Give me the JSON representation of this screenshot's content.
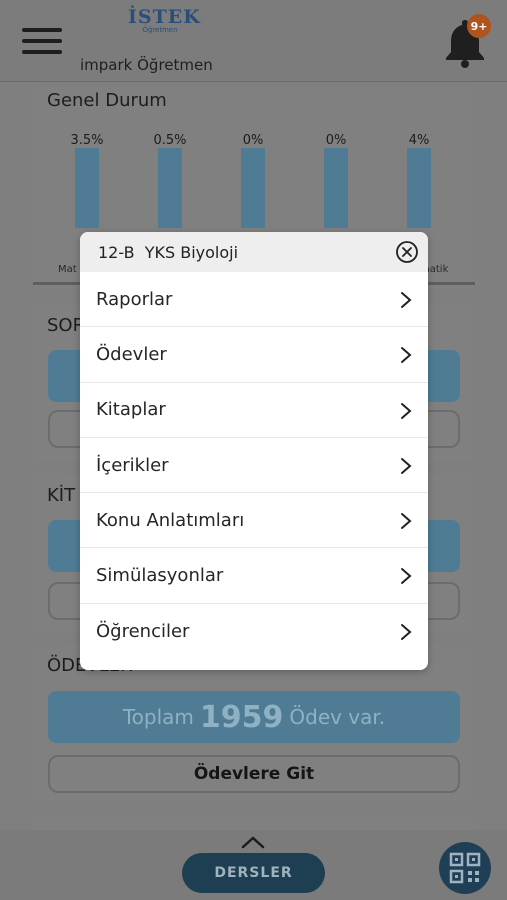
{
  "header": {
    "logo_text": "İSTEK",
    "logo_sub": "Öğretmen",
    "school_name": "impark Öğretmen",
    "notification_badge": "9+"
  },
  "genel_durum": {
    "title": "Genel Durum",
    "chart_data": {
      "type": "bar",
      "categories": [
        "Mat",
        "",
        "",
        "",
        "matik"
      ],
      "values": [
        3.5,
        0.5,
        0,
        0,
        4
      ],
      "value_labels": [
        "3.5%",
        "0.5%",
        "0%",
        "0%",
        "4%"
      ],
      "title": "",
      "xlabel": "",
      "ylabel": ""
    }
  },
  "sorular": {
    "title_partial": "SOR"
  },
  "kitaplar": {
    "title_partial": "KİT"
  },
  "odevler": {
    "title_partial": "ÖDEVLER",
    "total_prefix": "Toplam",
    "total_count": "1959",
    "total_suffix": "Ödev var.",
    "go_button": "Ödevlere Git"
  },
  "bottom": {
    "dersler_label": "DERSLER"
  },
  "modal": {
    "title": "12-B  YKS Biyoloji",
    "items": [
      {
        "label": "Raporlar"
      },
      {
        "label": "Ödevler"
      },
      {
        "label": "Kitaplar"
      },
      {
        "label": "İçerikler"
      },
      {
        "label": "Konu Anlatımları"
      },
      {
        "label": "Simülasyonlar"
      },
      {
        "label": "Öğrenciler"
      }
    ]
  },
  "colors": {
    "accent_blue": "#4f7c94",
    "dark_navy": "#1e3e52",
    "badge_orange": "#b0541f"
  }
}
